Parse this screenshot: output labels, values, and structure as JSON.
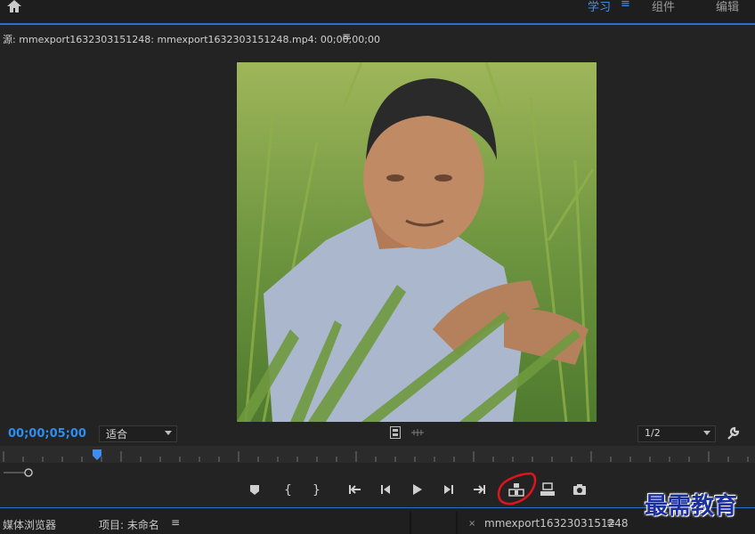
{
  "header": {
    "workspaces": [
      {
        "label": "学习",
        "active": true
      },
      {
        "label": "组件",
        "active": false
      },
      {
        "label": "编辑",
        "active": false
      }
    ],
    "menu_icon": "hamburger-icon"
  },
  "source_panel": {
    "title": "源: mmexport1632303151248: mmexport1632303151248.mp4: 00;00;00;00",
    "menu_glyph": "≡"
  },
  "viewer": {
    "timecode": "00;00;05;00",
    "fit_value": "适合",
    "resolution_value": "1/2",
    "image_subject": "photo-still"
  },
  "transport": {
    "buttons": [
      "add-marker-icon",
      "mark-in-icon",
      "mark-out-icon",
      "go-to-in-icon",
      "step-back-icon",
      "play-icon",
      "step-forward-icon",
      "go-to-out-icon",
      "insert-icon",
      "overwrite-icon",
      "export-frame-icon"
    ]
  },
  "bottom_tabs": {
    "media_browser": "媒体浏览器",
    "project": "项目: 未命名",
    "menu_glyph": "≡",
    "close_glyph": "×",
    "sequence": "mmexport1632303151248",
    "sequence_menu_glyph": "≡"
  },
  "watermark": "最需教育",
  "colors": {
    "accent": "#2e8df0",
    "panel_bg": "#232323",
    "annotation": "#e0141e"
  }
}
